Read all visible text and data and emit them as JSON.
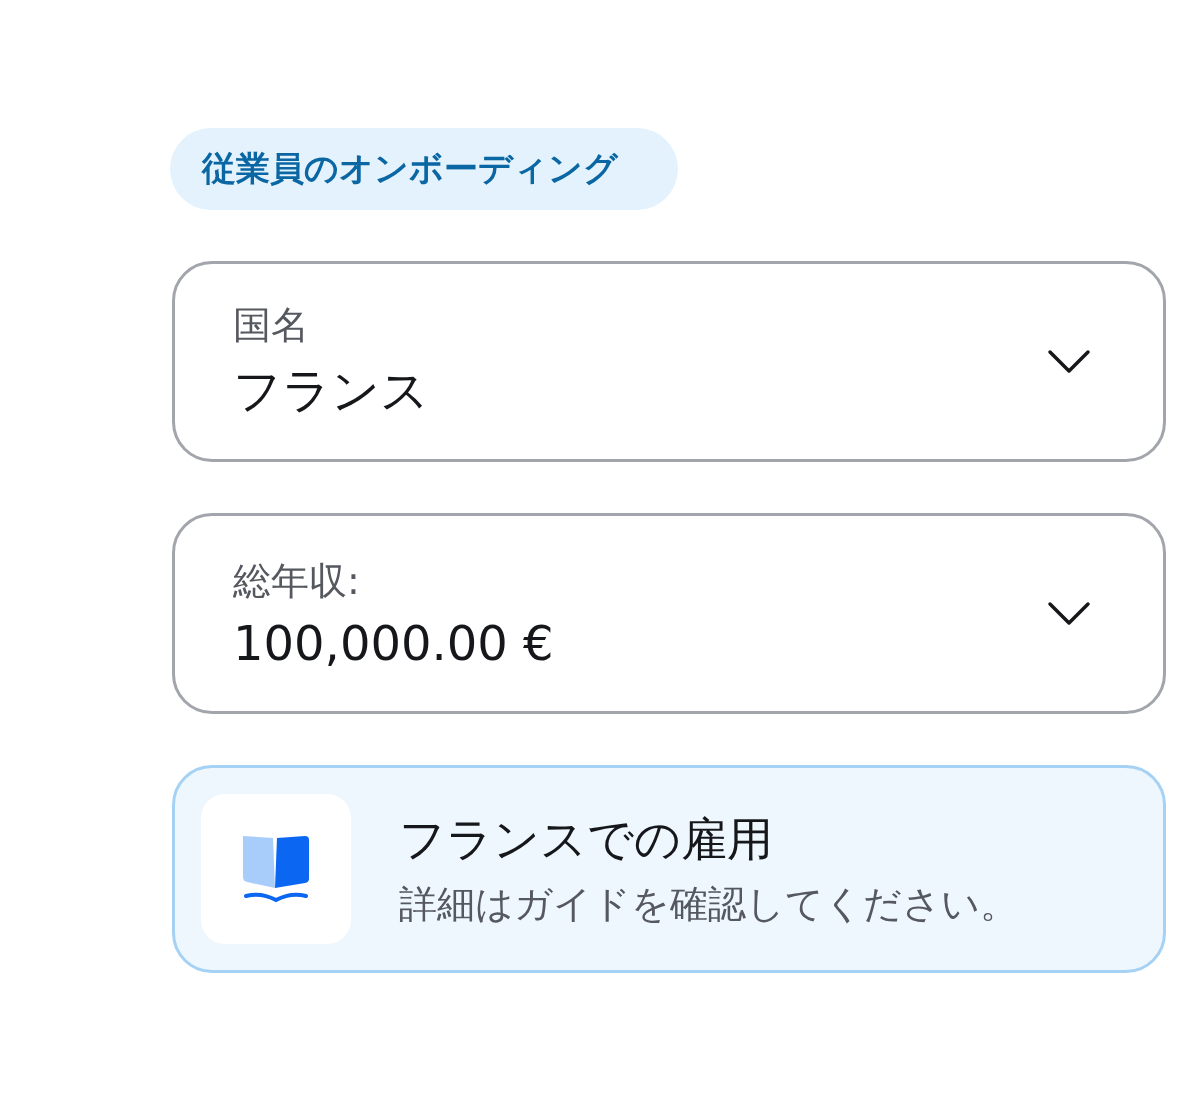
{
  "badge": "従業員のオンボーディング",
  "fields": [
    {
      "label": "国名",
      "value": "フランス"
    },
    {
      "label": "総年収:",
      "value": "100,000.00 €"
    }
  ],
  "guide_card": {
    "title": "フランスでの雇用",
    "subtitle": "詳細はガイドを確認してください。"
  }
}
